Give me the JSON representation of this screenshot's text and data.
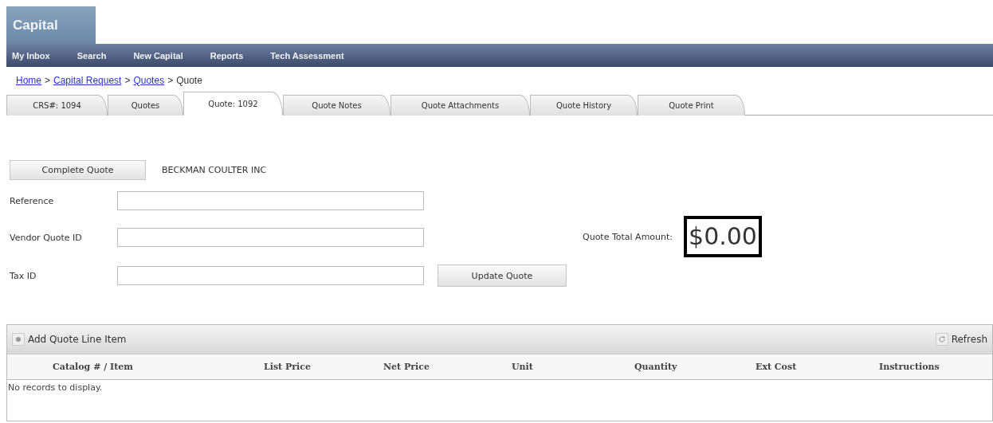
{
  "app": {
    "title": "Capital"
  },
  "nav": [
    "My Inbox",
    "Search",
    "New Capital",
    "Reports",
    "Tech Assessment"
  ],
  "breadcrumb": [
    {
      "label": "Home",
      "kind": "link"
    },
    {
      "label": ">",
      "kind": "sep"
    },
    {
      "label": "Capital Request",
      "kind": "link"
    },
    {
      "label": ">",
      "kind": "sep"
    },
    {
      "label": "Quotes",
      "kind": "link"
    },
    {
      "label": ">",
      "kind": "sep"
    },
    {
      "label": "Quote",
      "kind": "current"
    }
  ],
  "tabs": [
    {
      "label": "CRS#: 1094",
      "selected": false
    },
    {
      "label": "Quotes",
      "selected": false
    },
    {
      "label": "Quote: 1092",
      "selected": true
    },
    {
      "label": "Quote Notes",
      "selected": false
    },
    {
      "label": "Quote Attachments",
      "selected": false
    },
    {
      "label": "Quote History",
      "selected": false
    },
    {
      "label": "Quote Print",
      "selected": false
    }
  ],
  "form": {
    "complete_button": "Complete Quote",
    "vendor": "BECKMAN COULTER INC",
    "fields": [
      {
        "label": "Reference"
      },
      {
        "label": "Vendor Quote ID"
      },
      {
        "label": "Tax ID"
      }
    ],
    "update_button": "Update Quote",
    "total_label": "Quote Total Amount:",
    "total": "$0.00"
  },
  "grid": {
    "add_button": "Add Quote Line Item",
    "refresh_button": "Refresh",
    "columns": [
      "Catalog # / Item",
      "List Price",
      "Net Price",
      "Unit",
      "Quantity",
      "Ext Cost",
      "Instructions"
    ],
    "empty_text": "No records to display."
  }
}
